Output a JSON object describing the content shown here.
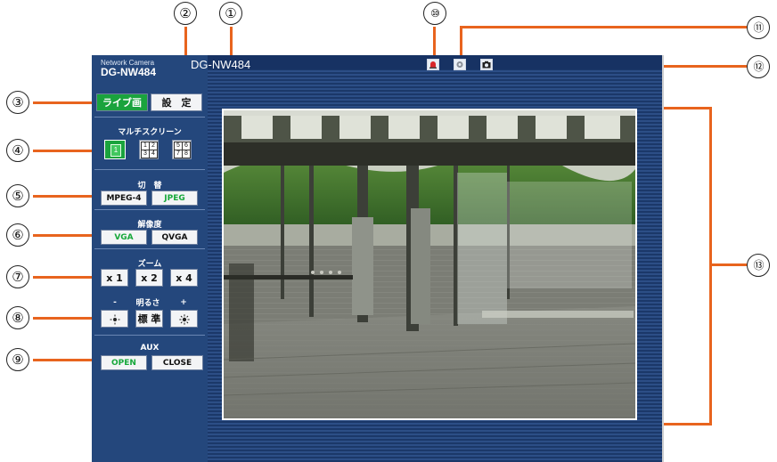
{
  "callouts": [
    "①",
    "②",
    "③",
    "④",
    "⑤",
    "⑥",
    "⑦",
    "⑧",
    "⑨",
    "⑩",
    "⑪",
    "⑫",
    "⑬"
  ],
  "header": {
    "brand_top": "Network Camera",
    "brand_model": "DG-NW484",
    "camera_title": "DG-NW484"
  },
  "toolbar": {
    "icons": [
      "alarm-icon",
      "auto-track-icon",
      "snapshot-icon"
    ]
  },
  "tabs": {
    "live": "ライブ画",
    "settings": "設　定"
  },
  "multiscreen": {
    "label": "マルチスクリーン",
    "single": "1",
    "quad_a": [
      "1",
      "2",
      "3",
      "4"
    ],
    "quad_b": [
      "5",
      "6",
      "7",
      "8"
    ]
  },
  "codec": {
    "label": "切　替",
    "mpeg4": "MPEG-4",
    "jpeg": "JPEG"
  },
  "resolution": {
    "label": "解像度",
    "vga": "VGA",
    "qvga": "QVGA"
  },
  "zoom": {
    "label": "ズーム",
    "x1": "x 1",
    "x2": "x 2",
    "x4": "x 4"
  },
  "brightness": {
    "label": "明るさ",
    "minus": "-",
    "plus": "+",
    "standard": "標 準"
  },
  "aux": {
    "label": "AUX",
    "open": "OPEN",
    "close": "CLOSE"
  },
  "colors": {
    "accent": "#e8641e",
    "sidebar": "#24477c",
    "active": "#1aa33d"
  }
}
